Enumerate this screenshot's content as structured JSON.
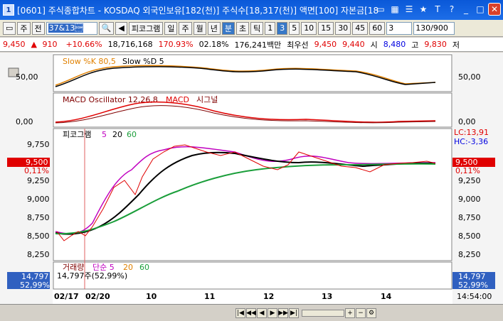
{
  "window": {
    "badge": "1",
    "title": "[0601] 주식종합차트 - KOSDAQ 외국인보유[182(천)] 주식수[18,317(천)] 액면[100] 자본금[18"
  },
  "titlebar_icons": [
    "restore-icon",
    "grid-icon",
    "list-icon",
    "star-icon",
    "text-icon",
    "help-icon",
    "minimize-icon",
    "maximize-icon",
    "close-icon"
  ],
  "toolbar": {
    "type_select": "주",
    "period_label": "전",
    "code_value": "37&13\u0001",
    "indicator_label": "피코그램",
    "periods": [
      "일",
      "주",
      "월",
      "년",
      "분",
      "초",
      "틱"
    ],
    "active_period": "분",
    "intervals": [
      "1",
      "3",
      "5",
      "10",
      "15",
      "30",
      "45",
      "60"
    ],
    "active_interval": "3",
    "count_value": "3",
    "range": "130/900"
  },
  "info": {
    "price": "9,450",
    "change": "910",
    "change_pct": "+10.66%",
    "volume": "18,716,168",
    "vol_ratio": "170.93%",
    "time": "02.18%",
    "trade_amount": "176,241백만",
    "best_label": "최우선",
    "best_price": "9,450",
    "ask_price": "9,440",
    "open_label": "시",
    "open_value": "8,480",
    "high_label": "고",
    "high_value": "9,830",
    "low_label": "저"
  },
  "panels": {
    "stoch_label": "Slow %K 80,5",
    "stoch_d_label": "Slow %D 5",
    "stoch_tick": "50,00",
    "macd_label": "MACD Oscillator 12,26,8",
    "macd_line_label": "MACD",
    "macd_signal_label": "시그널",
    "macd_tick": "0,00",
    "price_label": "피코그램",
    "ma1": "5",
    "ma2": "20",
    "ma3": "60",
    "lc": "LC:13,91",
    "hc": "HC:-3,36",
    "cur_price": "9,500",
    "cur_pct": "0,11%",
    "vol_label": "거래량",
    "vol_sub": "단순 5",
    "vol_ma1": "20",
    "vol_ma2": "60",
    "vol_value": "14,797주(52,99%)",
    "vol_tag": "14,797",
    "vol_pct": "52,99%"
  },
  "price_ticks": [
    "9,750",
    "9,500",
    "9,250",
    "9,000",
    "8,750",
    "8,500",
    "8,250"
  ],
  "x_labels": [
    "02/17",
    "02/20",
    "10",
    "11",
    "12",
    "13",
    "14"
  ],
  "clock": "14:54:00",
  "colors": {
    "up": "#e00000",
    "down": "#0000e0",
    "ma5": "#c000c0",
    "ma20": "#000000",
    "ma60": "#1a9e3a",
    "macd": "#e00000"
  }
}
